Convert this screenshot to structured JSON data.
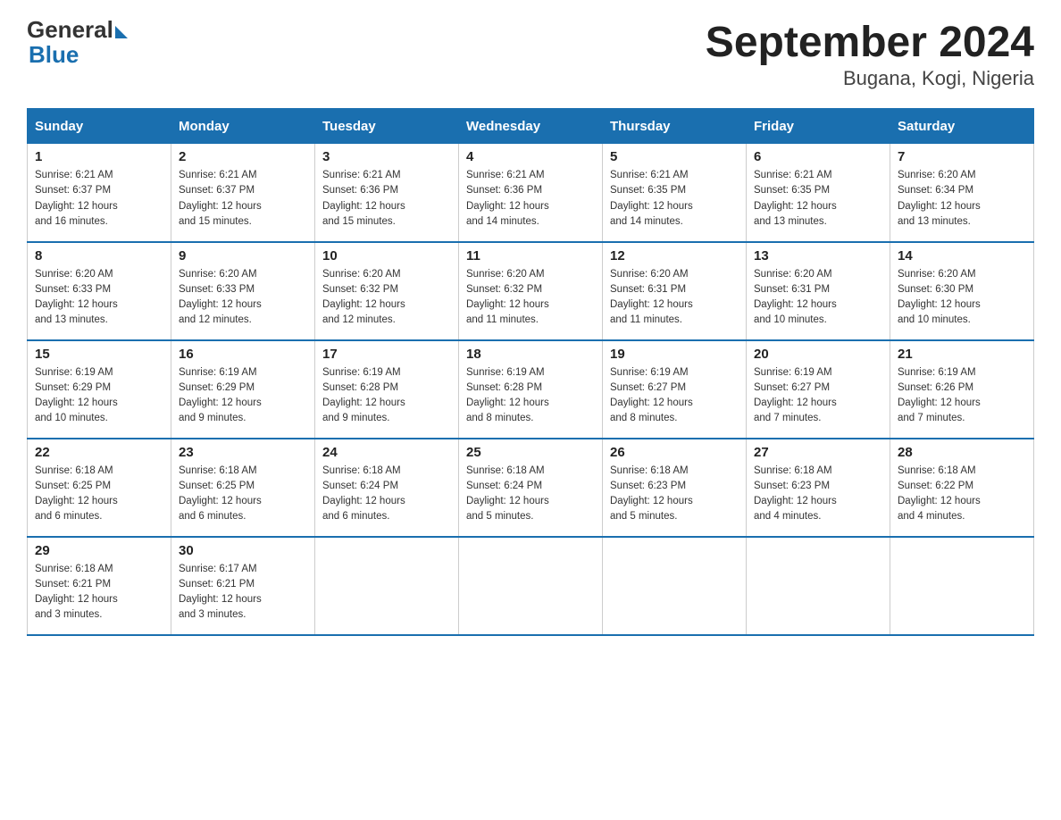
{
  "header": {
    "logo_general": "General",
    "logo_blue": "Blue",
    "title": "September 2024",
    "subtitle": "Bugana, Kogi, Nigeria"
  },
  "days_of_week": [
    "Sunday",
    "Monday",
    "Tuesday",
    "Wednesday",
    "Thursday",
    "Friday",
    "Saturday"
  ],
  "weeks": [
    [
      {
        "day": "1",
        "sunrise": "6:21 AM",
        "sunset": "6:37 PM",
        "daylight": "12 hours and 16 minutes."
      },
      {
        "day": "2",
        "sunrise": "6:21 AM",
        "sunset": "6:37 PM",
        "daylight": "12 hours and 15 minutes."
      },
      {
        "day": "3",
        "sunrise": "6:21 AM",
        "sunset": "6:36 PM",
        "daylight": "12 hours and 15 minutes."
      },
      {
        "day": "4",
        "sunrise": "6:21 AM",
        "sunset": "6:36 PM",
        "daylight": "12 hours and 14 minutes."
      },
      {
        "day": "5",
        "sunrise": "6:21 AM",
        "sunset": "6:35 PM",
        "daylight": "12 hours and 14 minutes."
      },
      {
        "day": "6",
        "sunrise": "6:21 AM",
        "sunset": "6:35 PM",
        "daylight": "12 hours and 13 minutes."
      },
      {
        "day": "7",
        "sunrise": "6:20 AM",
        "sunset": "6:34 PM",
        "daylight": "12 hours and 13 minutes."
      }
    ],
    [
      {
        "day": "8",
        "sunrise": "6:20 AM",
        "sunset": "6:33 PM",
        "daylight": "12 hours and 13 minutes."
      },
      {
        "day": "9",
        "sunrise": "6:20 AM",
        "sunset": "6:33 PM",
        "daylight": "12 hours and 12 minutes."
      },
      {
        "day": "10",
        "sunrise": "6:20 AM",
        "sunset": "6:32 PM",
        "daylight": "12 hours and 12 minutes."
      },
      {
        "day": "11",
        "sunrise": "6:20 AM",
        "sunset": "6:32 PM",
        "daylight": "12 hours and 11 minutes."
      },
      {
        "day": "12",
        "sunrise": "6:20 AM",
        "sunset": "6:31 PM",
        "daylight": "12 hours and 11 minutes."
      },
      {
        "day": "13",
        "sunrise": "6:20 AM",
        "sunset": "6:31 PM",
        "daylight": "12 hours and 10 minutes."
      },
      {
        "day": "14",
        "sunrise": "6:20 AM",
        "sunset": "6:30 PM",
        "daylight": "12 hours and 10 minutes."
      }
    ],
    [
      {
        "day": "15",
        "sunrise": "6:19 AM",
        "sunset": "6:29 PM",
        "daylight": "12 hours and 10 minutes."
      },
      {
        "day": "16",
        "sunrise": "6:19 AM",
        "sunset": "6:29 PM",
        "daylight": "12 hours and 9 minutes."
      },
      {
        "day": "17",
        "sunrise": "6:19 AM",
        "sunset": "6:28 PM",
        "daylight": "12 hours and 9 minutes."
      },
      {
        "day": "18",
        "sunrise": "6:19 AM",
        "sunset": "6:28 PM",
        "daylight": "12 hours and 8 minutes."
      },
      {
        "day": "19",
        "sunrise": "6:19 AM",
        "sunset": "6:27 PM",
        "daylight": "12 hours and 8 minutes."
      },
      {
        "day": "20",
        "sunrise": "6:19 AM",
        "sunset": "6:27 PM",
        "daylight": "12 hours and 7 minutes."
      },
      {
        "day": "21",
        "sunrise": "6:19 AM",
        "sunset": "6:26 PM",
        "daylight": "12 hours and 7 minutes."
      }
    ],
    [
      {
        "day": "22",
        "sunrise": "6:18 AM",
        "sunset": "6:25 PM",
        "daylight": "12 hours and 6 minutes."
      },
      {
        "day": "23",
        "sunrise": "6:18 AM",
        "sunset": "6:25 PM",
        "daylight": "12 hours and 6 minutes."
      },
      {
        "day": "24",
        "sunrise": "6:18 AM",
        "sunset": "6:24 PM",
        "daylight": "12 hours and 6 minutes."
      },
      {
        "day": "25",
        "sunrise": "6:18 AM",
        "sunset": "6:24 PM",
        "daylight": "12 hours and 5 minutes."
      },
      {
        "day": "26",
        "sunrise": "6:18 AM",
        "sunset": "6:23 PM",
        "daylight": "12 hours and 5 minutes."
      },
      {
        "day": "27",
        "sunrise": "6:18 AM",
        "sunset": "6:23 PM",
        "daylight": "12 hours and 4 minutes."
      },
      {
        "day": "28",
        "sunrise": "6:18 AM",
        "sunset": "6:22 PM",
        "daylight": "12 hours and 4 minutes."
      }
    ],
    [
      {
        "day": "29",
        "sunrise": "6:18 AM",
        "sunset": "6:21 PM",
        "daylight": "12 hours and 3 minutes."
      },
      {
        "day": "30",
        "sunrise": "6:17 AM",
        "sunset": "6:21 PM",
        "daylight": "12 hours and 3 minutes."
      },
      null,
      null,
      null,
      null,
      null
    ]
  ],
  "labels": {
    "sunrise": "Sunrise:",
    "sunset": "Sunset:",
    "daylight": "Daylight:"
  }
}
